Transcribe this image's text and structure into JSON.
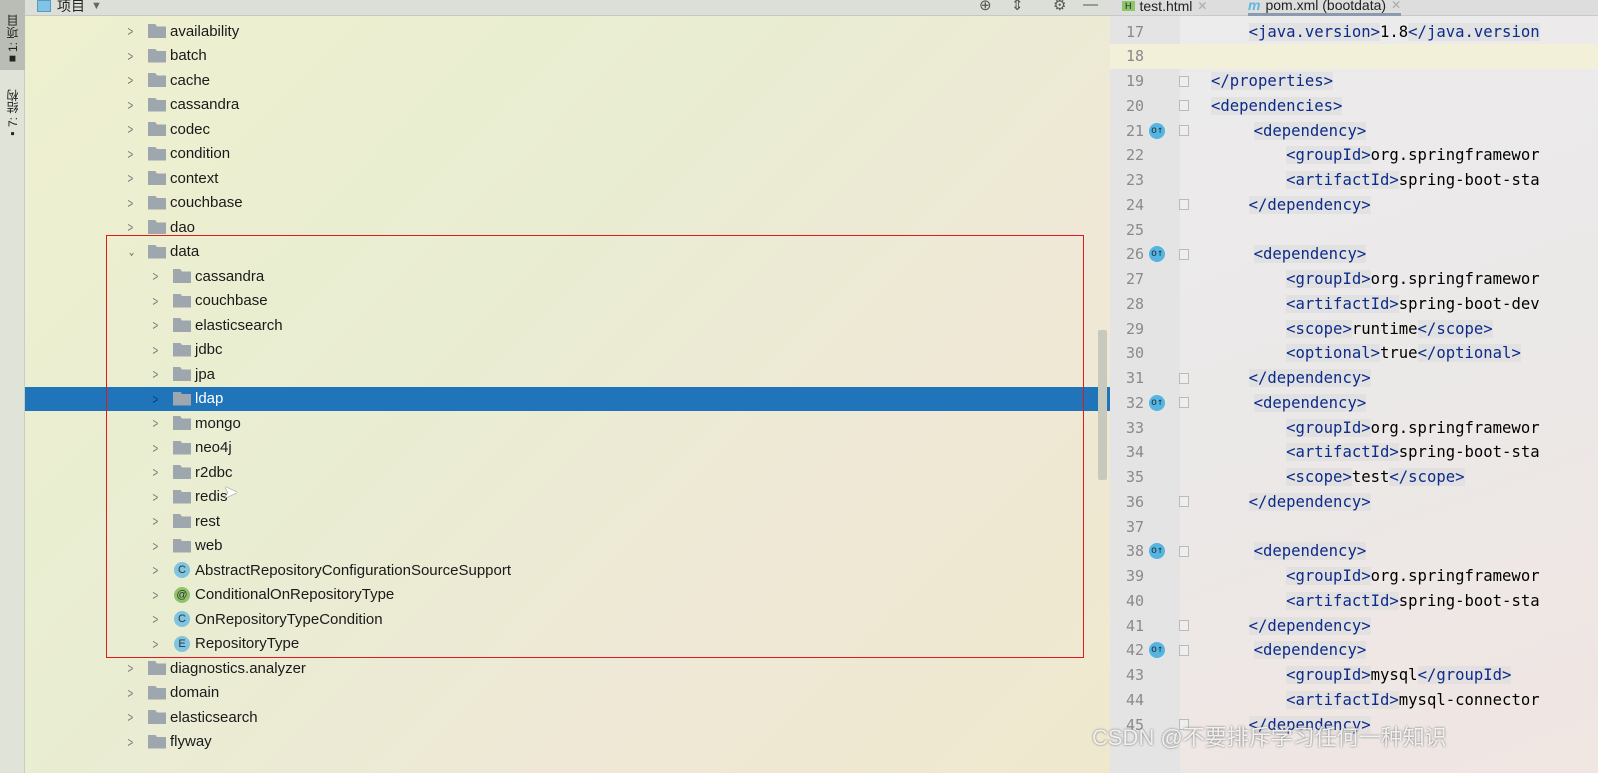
{
  "toolstrip": {
    "tabs": [
      {
        "label": "1: 项目",
        "icon": "folder-icon"
      },
      {
        "label": "7: 结构",
        "icon": "structure-icon"
      }
    ]
  },
  "project": {
    "header": {
      "title": "项目",
      "icons": [
        "locate-icon",
        "collapse-icon",
        "gear-icon",
        "minimize-icon"
      ]
    },
    "rows": [
      {
        "label": "availability",
        "level": 1,
        "type": "folder"
      },
      {
        "label": "batch",
        "level": 1,
        "type": "folder"
      },
      {
        "label": "cache",
        "level": 1,
        "type": "folder"
      },
      {
        "label": "cassandra",
        "level": 1,
        "type": "folder"
      },
      {
        "label": "codec",
        "level": 1,
        "type": "folder"
      },
      {
        "label": "condition",
        "level": 1,
        "type": "folder"
      },
      {
        "label": "context",
        "level": 1,
        "type": "folder"
      },
      {
        "label": "couchbase",
        "level": 1,
        "type": "folder"
      },
      {
        "label": "dao",
        "level": 1,
        "type": "folder"
      },
      {
        "label": "data",
        "level": 1,
        "type": "folder",
        "expanded": true
      },
      {
        "label": "cassandra",
        "level": 2,
        "type": "folder"
      },
      {
        "label": "couchbase",
        "level": 2,
        "type": "folder"
      },
      {
        "label": "elasticsearch",
        "level": 2,
        "type": "folder"
      },
      {
        "label": "jdbc",
        "level": 2,
        "type": "folder"
      },
      {
        "label": "jpa",
        "level": 2,
        "type": "folder"
      },
      {
        "label": "ldap",
        "level": 2,
        "type": "folder",
        "selected": true
      },
      {
        "label": "mongo",
        "level": 2,
        "type": "folder"
      },
      {
        "label": "neo4j",
        "level": 2,
        "type": "folder"
      },
      {
        "label": "r2dbc",
        "level": 2,
        "type": "folder"
      },
      {
        "label": "redis",
        "level": 2,
        "type": "folder"
      },
      {
        "label": "rest",
        "level": 2,
        "type": "folder"
      },
      {
        "label": "web",
        "level": 2,
        "type": "folder"
      },
      {
        "label": "AbstractRepositoryConfigurationSourceSupport",
        "level": 2,
        "type": "class",
        "badge": "C",
        "color": "#7fc4e0"
      },
      {
        "label": "ConditionalOnRepositoryType",
        "level": 2,
        "type": "annotation",
        "badge": "@",
        "color": "#8fc46a"
      },
      {
        "label": "OnRepositoryTypeCondition",
        "level": 2,
        "type": "class",
        "badge": "C",
        "color": "#7fc4e0"
      },
      {
        "label": "RepositoryType",
        "level": 2,
        "type": "enum",
        "badge": "E",
        "color": "#7fc4e0"
      },
      {
        "label": "diagnostics.analyzer",
        "level": 1,
        "type": "folder"
      },
      {
        "label": "domain",
        "level": 1,
        "type": "folder"
      },
      {
        "label": "elasticsearch",
        "level": 1,
        "type": "folder"
      },
      {
        "label": "flyway",
        "level": 1,
        "type": "folder"
      }
    ],
    "highlight_color": "#e01a1a",
    "selection_color": "#1f74ba"
  },
  "editor": {
    "tabs": [
      {
        "label": "test.html",
        "icon": "html-file-icon"
      },
      {
        "label": "pom.xml (bootdata)",
        "icon": "maven-icon",
        "active": true
      }
    ],
    "lines": [
      {
        "n": "17",
        "text": "    <java.version>1.8</java.version"
      },
      {
        "n": "18",
        "text": "",
        "current": true
      },
      {
        "n": "19",
        "text": "</properties>",
        "fold": true
      },
      {
        "n": "20",
        "text": "<dependencies>",
        "fold": true
      },
      {
        "n": "21",
        "text": "    <dependency>",
        "fold": true,
        "override": true
      },
      {
        "n": "22",
        "text": "        <groupId>org.springframewor"
      },
      {
        "n": "23",
        "text": "        <artifactId>spring-boot-sta"
      },
      {
        "n": "24",
        "text": "    </dependency>",
        "fold": true
      },
      {
        "n": "25",
        "text": ""
      },
      {
        "n": "26",
        "text": "    <dependency>",
        "fold": true,
        "override": true
      },
      {
        "n": "27",
        "text": "        <groupId>org.springframewor"
      },
      {
        "n": "28",
        "text": "        <artifactId>spring-boot-dev"
      },
      {
        "n": "29",
        "text": "        <scope>runtime</scope>"
      },
      {
        "n": "30",
        "text": "        <optional>true</optional>"
      },
      {
        "n": "31",
        "text": "    </dependency>",
        "fold": true
      },
      {
        "n": "32",
        "text": "    <dependency>",
        "fold": true,
        "override": true
      },
      {
        "n": "33",
        "text": "        <groupId>org.springframewor"
      },
      {
        "n": "34",
        "text": "        <artifactId>spring-boot-sta"
      },
      {
        "n": "35",
        "text": "        <scope>test</scope>"
      },
      {
        "n": "36",
        "text": "    </dependency>",
        "fold": true
      },
      {
        "n": "37",
        "text": ""
      },
      {
        "n": "38",
        "text": "    <dependency>",
        "fold": true,
        "override": true
      },
      {
        "n": "39",
        "text": "        <groupId>org.springframewor"
      },
      {
        "n": "40",
        "text": "        <artifactId>spring-boot-sta"
      },
      {
        "n": "41",
        "text": "    </dependency>",
        "fold": true
      },
      {
        "n": "42",
        "text": "    <dependency>",
        "fold": true,
        "override": true
      },
      {
        "n": "43",
        "text": "        <groupId>mysql</groupId>"
      },
      {
        "n": "44",
        "text": "        <artifactId>mysql-connector"
      },
      {
        "n": "45",
        "text": "    </dependency>",
        "fold": true
      }
    ]
  },
  "watermark": "CSDN @不要排斥学习任何一种知识"
}
